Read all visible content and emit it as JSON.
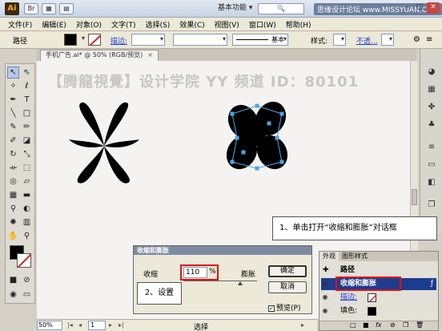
{
  "titlebar": {
    "app_logo": "Ai",
    "workspace": "基本功能",
    "watermark": "思缘设计论坛 www.MISSYUAN.COM",
    "minimize": "–",
    "maximize": "□",
    "close": "✕"
  },
  "menubar": {
    "items": [
      "文件(F)",
      "编辑(E)",
      "对象(O)",
      "文字(T)",
      "选择(S)",
      "效果(C)",
      "视图(V)",
      "窗口(W)",
      "帮助(H)"
    ]
  },
  "controlbar": {
    "selection_label": "路径",
    "stroke_link": "描边:",
    "stroke_style": "基本",
    "style_label": "样式:",
    "opacity_link": "不透..."
  },
  "document_tab": {
    "label": "手机广告.ai* @ 50% (RGB/预览)",
    "close": "×"
  },
  "canvas": {
    "watermark_text": "【腾龍視覺】设计学院 YY 频道 ID：80101"
  },
  "callouts": {
    "step1": "1、单击打开“收缩和膨胀”对话框",
    "step2": "2、设置"
  },
  "dialog": {
    "title": "收缩和膨胀",
    "shrink_label": "收缩",
    "bloat_label": "膨胀",
    "value": "110",
    "unit": "%",
    "slider_value_percent": 110,
    "ok_label": "确定",
    "cancel_label": "取消",
    "preview_label": "预览(P)",
    "preview_checked": true
  },
  "appearance_panel": {
    "tabs": [
      "外观",
      "图形样式"
    ],
    "object_label": "路径",
    "effect_row": "收缩和膨胀",
    "stroke_label": "描边:",
    "fill_label": "填色:",
    "colors": {
      "fill": "#000000",
      "selection": "#1d3c8f",
      "highlight": "#e01010"
    }
  },
  "statusbar": {
    "zoom": "50%",
    "page": "1",
    "selection_tool": "选择"
  },
  "icons": {
    "selection": "arrow-icon",
    "direct_selection": "white-arrow-icon",
    "pen": "pen-icon",
    "type": "type-icon",
    "hand": "hand-icon",
    "zoom": "magnifier-icon",
    "eye": "eye-icon"
  }
}
